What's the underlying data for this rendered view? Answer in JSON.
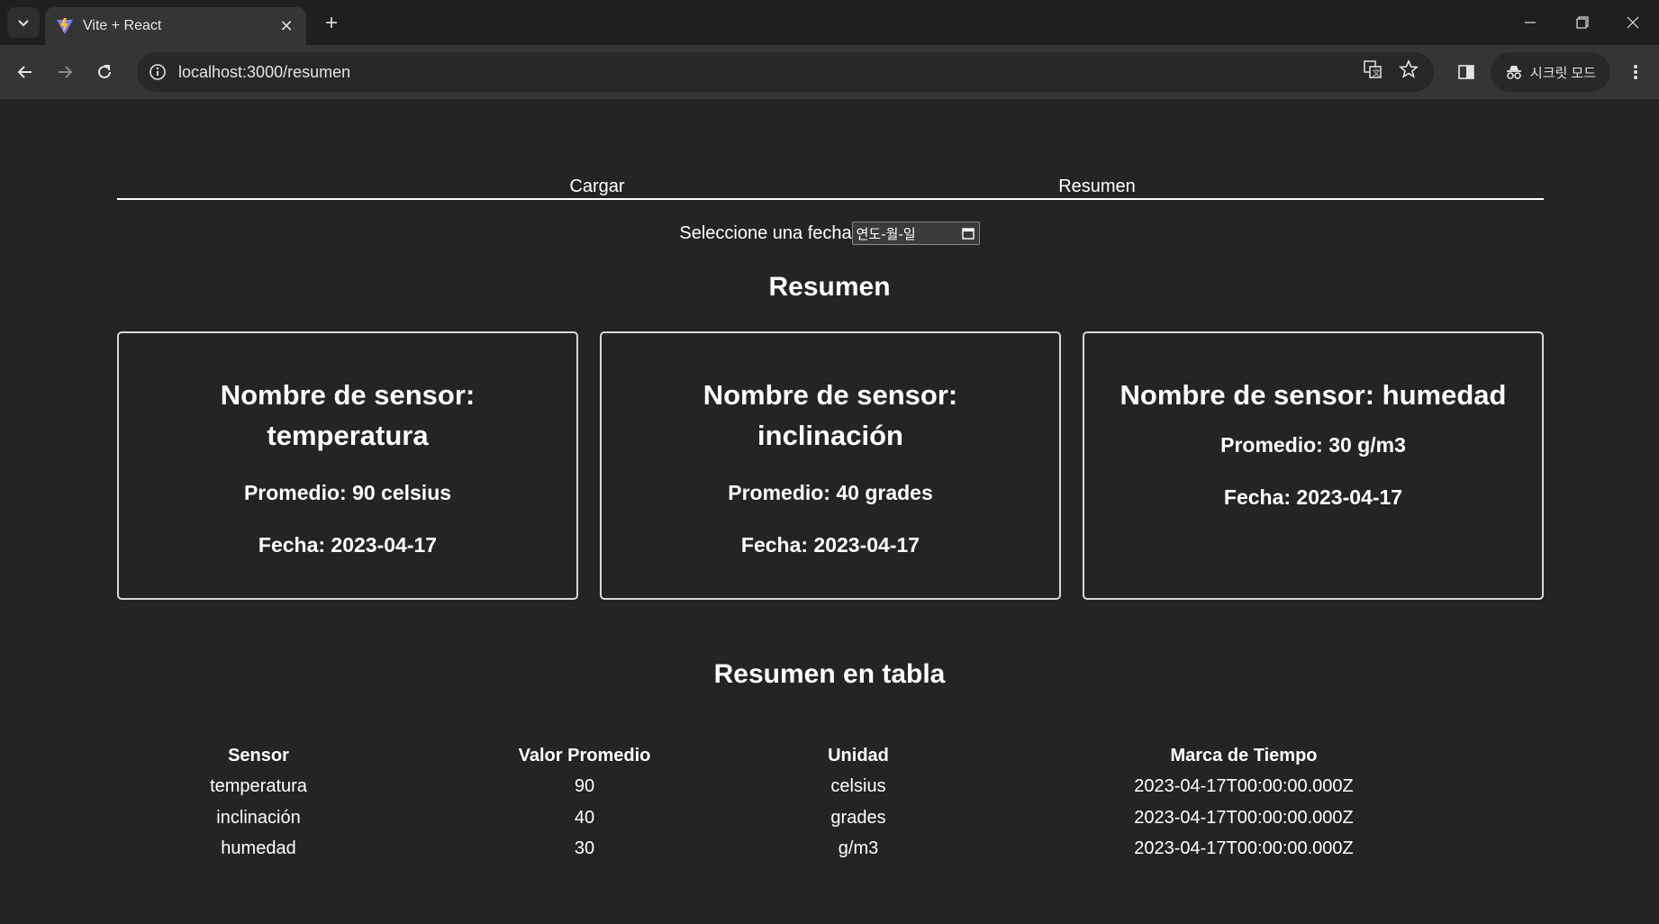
{
  "browser": {
    "tab_title": "Vite + React",
    "url": "localhost:3000/resumen",
    "incognito_label": "시크릿 모드",
    "icons": [
      "tab-list-icon",
      "vite-logo-icon",
      "close-icon",
      "plus-icon",
      "minimize-icon",
      "restore-icon",
      "window-close-icon",
      "back-arrow-icon",
      "forward-arrow-icon",
      "reload-icon",
      "site-info-icon",
      "translate-icon",
      "star-icon",
      "side-panel-icon",
      "incognito-icon",
      "kebab-menu-icon"
    ]
  },
  "nav": {
    "cargar": "Cargar",
    "resumen": "Resumen"
  },
  "date_filter": {
    "label": "Seleccione una fecha",
    "placeholder": "연도-월-일"
  },
  "heading": "Resumen",
  "cards": [
    {
      "title": "Nombre de sensor: temperatura",
      "promedio": "Promedio: 90 celsius",
      "fecha": "Fecha: 2023-04-17"
    },
    {
      "title": "Nombre de sensor: inclinación",
      "promedio": "Promedio: 40 grades",
      "fecha": "Fecha: 2023-04-17"
    },
    {
      "title": "Nombre de sensor: humedad",
      "promedio": "Promedio: 30 g/m3",
      "fecha": "Fecha: 2023-04-17"
    }
  ],
  "table_heading": "Resumen en tabla",
  "table": {
    "headers": [
      "Sensor",
      "Valor Promedio",
      "Unidad",
      "Marca de Tiempo"
    ],
    "rows": [
      [
        "temperatura",
        "90",
        "celsius",
        "2023-04-17T00:00:00.000Z"
      ],
      [
        "inclinación",
        "40",
        "grades",
        "2023-04-17T00:00:00.000Z"
      ],
      [
        "humedad",
        "30",
        "g/m3",
        "2023-04-17T00:00:00.000Z"
      ]
    ]
  },
  "colors": {
    "page_bg": "#242424",
    "chrome_bg": "#1f1f1f",
    "toolbar_bg": "#353535",
    "text": "#ffffff"
  }
}
